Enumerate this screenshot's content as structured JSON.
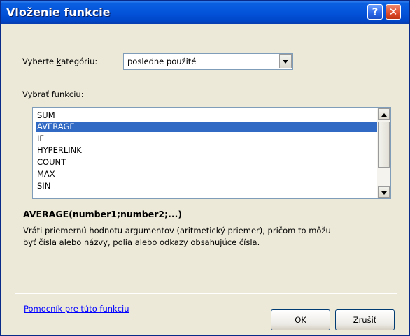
{
  "window": {
    "title": "Vloženie funkcie",
    "help_icon": "?",
    "close_icon": "✕"
  },
  "category": {
    "label_pre": "Vyberte ",
    "label_key": "k",
    "label_post": "ategóriu:",
    "selected": "posledne použité"
  },
  "function_list": {
    "label_key": "V",
    "label_post": "ybrať funkciu:",
    "items": [
      "SUM",
      "AVERAGE",
      "IF",
      "HYPERLINK",
      "COUNT",
      "MAX",
      "SIN"
    ],
    "selected": "AVERAGE"
  },
  "details": {
    "signature": "AVERAGE(number1;number2;...)",
    "description_line1": "Vráti priemernú hodnotu argumentov (aritmetický priemer), pričom to môžu",
    "description_line2": "byť čísla alebo názvy, polia alebo odkazy obsahujúce čísla."
  },
  "footer": {
    "help_link": "Pomocník pre túto funkciu",
    "ok_label": "OK",
    "cancel_label": "Zrušiť"
  },
  "colors": {
    "titlebar": "#0352d8",
    "selection": "#316ac5",
    "dialog_bg": "#ece9d8",
    "close_button": "#dd4a2a"
  },
  "icons": {
    "help": "help-icon",
    "close": "close-icon",
    "dropdown": "chevron-down-icon",
    "scroll_up": "scroll-up-icon",
    "scroll_down": "scroll-down-icon"
  }
}
